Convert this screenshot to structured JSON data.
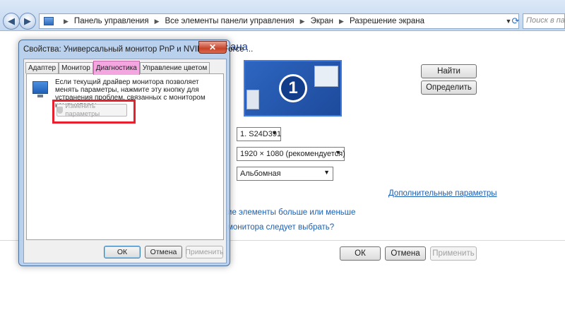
{
  "address_bar": {
    "segments": [
      "Панель управления",
      "Все элементы панели управления",
      "Экран",
      "Разрешение экрана"
    ],
    "search_placeholder": "Поиск в панели"
  },
  "background": {
    "heading": "ана",
    "identify_number": "1",
    "find_button": "Найти",
    "identify_button": "Определить",
    "display_select": "1. S24D391",
    "resolution_select": "1920 × 1080 (рекомендуется)",
    "orientation_select": "Альбомная",
    "advanced_link": "Дополнительные параметры",
    "link_size": "кие элементы больше или меньше",
    "link_which": "монитора следует выбрать?",
    "ok_button": "ОК",
    "cancel_button": "Отмена",
    "apply_button": "Применить"
  },
  "dialog": {
    "title": "Свойства: Универсальный монитор PnP и NVIDIA GeForce ...",
    "close_glyph": "✕",
    "tabs": [
      "Адаптер",
      "Монитор",
      "Диагностика",
      "Управление цветом"
    ],
    "active_tab": "Диагностика",
    "description": "Если текущий драйвер монитора позволяет менять параметры, нажмите эту кнопку для устранения проблем, связанных с монитором компьютера:",
    "change_button": "Изменить параметры",
    "ok_button": "ОК",
    "cancel_button": "Отмена",
    "apply_button": "Применить",
    "highlight_color": "#e8202e",
    "active_tab_color": "#f4a6e0"
  }
}
